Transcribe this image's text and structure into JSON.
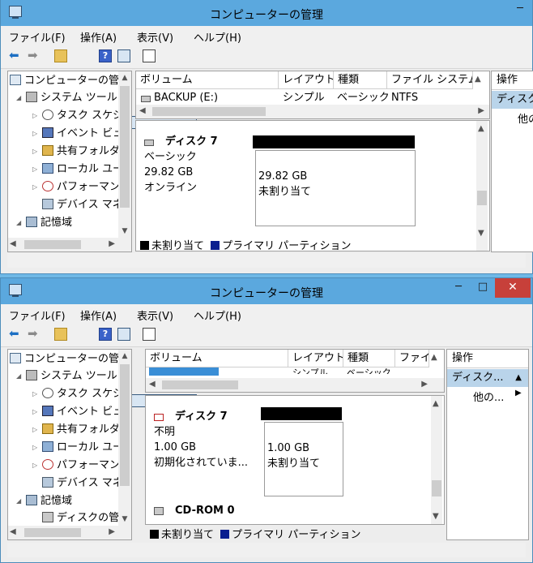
{
  "windows": [
    {
      "title": "コンピューターの管理",
      "controls": {
        "minimize": "─",
        "maximize": "□",
        "close": "✕"
      },
      "menu": [
        "ファイル(F)",
        "操作(A)",
        "表示(V)",
        "ヘルプ(H)"
      ],
      "tree": [
        {
          "label": "コンピューターの管理",
          "icon": "computer-icon"
        },
        {
          "label": "システム ツール",
          "icon": "tools-icon"
        },
        {
          "label": "タスク スケジュ",
          "icon": "clock-icon"
        },
        {
          "label": "イベント ビュ",
          "icon": "event-viewer-icon"
        },
        {
          "label": "共有フォルダ",
          "icon": "shared-folder-icon"
        },
        {
          "label": "ローカル ユー",
          "icon": "users-icon"
        },
        {
          "label": "パフォーマンス",
          "icon": "performance-icon"
        },
        {
          "label": "デバイス マネ",
          "icon": "device-manager-icon"
        },
        {
          "label": "記憶域",
          "icon": "storage-icon"
        }
      ],
      "columns": [
        "ボリューム",
        "レイアウト",
        "種類",
        "ファイル システム"
      ],
      "rows": [
        {
          "volume": "BACKUP (E:)",
          "layout": "シンプル",
          "type": "ベーシック",
          "fs": "NTFS"
        }
      ],
      "disk": {
        "name": "ディスク 7",
        "type": "ベーシック",
        "size": "29.82 GB",
        "status": "オンライン",
        "part_size": "29.82 GB",
        "part_label": "未割り当て"
      },
      "legend": {
        "unallocated": "未割り当て",
        "primary": "プライマリ パーティション"
      },
      "actions": {
        "header": "操作",
        "selected": "ディスク...",
        "sub": "他の"
      }
    },
    {
      "title": "コンピューターの管理",
      "controls": {
        "minimize": "─",
        "maximize": "□",
        "close": "✕"
      },
      "menu": [
        "ファイル(F)",
        "操作(A)",
        "表示(V)",
        "ヘルプ(H)"
      ],
      "tree": [
        {
          "label": "コンピューターの管理",
          "icon": "computer-icon"
        },
        {
          "label": "システム ツール",
          "icon": "tools-icon"
        },
        {
          "label": "タスク スケジュー",
          "icon": "clock-icon"
        },
        {
          "label": "イベント ビュー",
          "icon": "event-viewer-icon"
        },
        {
          "label": "共有フォルダー",
          "icon": "shared-folder-icon"
        },
        {
          "label": "ローカル ユーザ",
          "icon": "users-icon"
        },
        {
          "label": "パフォーマンス",
          "icon": "performance-icon"
        },
        {
          "label": "デバイス マネー",
          "icon": "device-manager-icon"
        },
        {
          "label": "記憶域",
          "icon": "storage-icon"
        },
        {
          "label": "ディスクの管理",
          "icon": "disk-management-icon"
        }
      ],
      "columns": [
        "ボリューム",
        "レイアウト",
        "種類",
        "ファイ"
      ],
      "rows": [
        {
          "volume": "",
          "layout": "シンプル",
          "type": "ベーシック",
          "fs": ""
        }
      ],
      "disk": {
        "name": "ディスク 7",
        "type": "不明",
        "size": "1.00 GB",
        "status": "初期化されていま...",
        "part_size": "1.00 GB",
        "part_label": "未割り当て"
      },
      "cdrom": "CD-ROM 0",
      "legend": {
        "unallocated": "未割り当て",
        "primary": "プライマリ パーティション"
      },
      "actions": {
        "header": "操作",
        "selected": "ディスク...",
        "sub": "他の..."
      }
    }
  ],
  "colors": {
    "titlebar": "#5ba8de",
    "unallocated": "#000000",
    "primary": "#0a1f8f",
    "selection": "#b9d4ea"
  }
}
